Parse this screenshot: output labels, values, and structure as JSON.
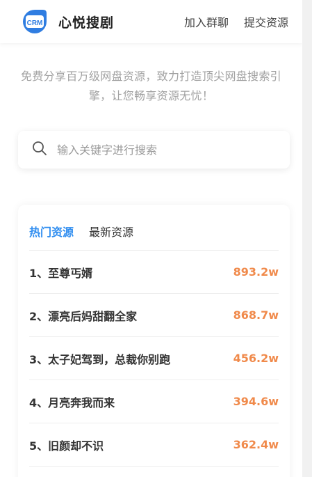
{
  "header": {
    "brand": "心悦搜剧",
    "logo_text": "CRM",
    "nav": [
      "加入群聊",
      "提交资源"
    ]
  },
  "tagline": "免费分享百万级网盘资源，致力打造顶尖网盘搜索引擎，让您畅享资源无忧！",
  "search": {
    "placeholder": "输入关键字进行搜索",
    "icon": "search-icon"
  },
  "tabs": [
    {
      "label": "热门资源",
      "active": true
    },
    {
      "label": "最新资源",
      "active": false
    }
  ],
  "hot_list": [
    {
      "title": "1、至尊丐婿",
      "count": "893.2w"
    },
    {
      "title": "2、漂亮后妈甜翻全家",
      "count": "868.7w"
    },
    {
      "title": "3、太子妃驾到，总裁你别跑",
      "count": "456.2w"
    },
    {
      "title": "4、月亮奔我而来",
      "count": "394.6w"
    },
    {
      "title": "5、旧颜却不识",
      "count": "362.4w"
    }
  ],
  "colors": {
    "accent": "#2f8df0",
    "count": "#f08a4b",
    "logo": "#2f7de1"
  }
}
